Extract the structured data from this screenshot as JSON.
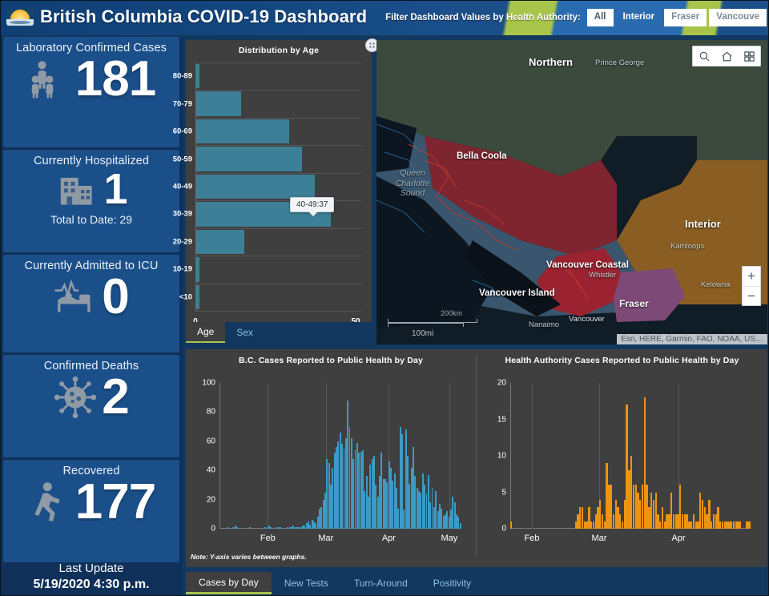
{
  "header": {
    "title": "British Columbia COVID-19 Dashboard",
    "logo_icon": "bc-sun-logo",
    "filter_label": "Filter Dashboard Values by Health Authority:",
    "filters": [
      {
        "label": "All",
        "state": "selected"
      },
      {
        "label": "Interior",
        "state": "unselected"
      },
      {
        "label": "Fraser",
        "state": "box"
      },
      {
        "label": "Vancouve",
        "state": "box"
      }
    ],
    "accent_green": "#a8c44a",
    "brand_blue": "#1b4f8a"
  },
  "kpis": [
    {
      "title": "Laboratory Confirmed Cases",
      "value": "181",
      "sub": "",
      "icon": "people-icon"
    },
    {
      "title": "Currently Hospitalized",
      "value": "1",
      "sub": "Total to Date: 29",
      "icon": "hospital-icon"
    },
    {
      "title": "Currently Admitted to ICU",
      "value": "0",
      "sub": "",
      "icon": "icu-bed-icon"
    },
    {
      "title": "Confirmed Deaths",
      "value": "2",
      "sub": "",
      "icon": "virus-icon"
    },
    {
      "title": "Recovered",
      "value": "177",
      "sub": "",
      "icon": "walking-person-icon"
    }
  ],
  "last_update": {
    "label": "Last Update",
    "datetime": "5/19/2020 4:30 p.m."
  },
  "age_panel": {
    "expand_icon": "expand-options-icon",
    "tabs": [
      {
        "label": "Age",
        "active": true
      },
      {
        "label": "Sex",
        "active": false
      }
    ],
    "tooltip": "40-49:37"
  },
  "map": {
    "tools": [
      {
        "name": "search-icon",
        "label": "Search"
      },
      {
        "name": "home-icon",
        "label": "Default extent"
      },
      {
        "name": "basemap-gallery-icon",
        "label": "Basemap gallery"
      }
    ],
    "zoom_in": "+",
    "zoom_out": "−",
    "scale_km": "200km",
    "scale_mi": "100mi",
    "attribution": "Esri, HERE, Garmin, FAO, NOAA, US…",
    "regions": [
      {
        "label": "Northern",
        "color": "#3d4a3a"
      },
      {
        "label": "Interior",
        "color": "#8a5a1e"
      },
      {
        "label": "Vancouver Coastal",
        "color": "#8c2330"
      },
      {
        "label": "Fraser",
        "color": "#7d4a78"
      },
      {
        "label": "Vancouver Island",
        "color": "#3c5870"
      }
    ],
    "cities": [
      "Prince George",
      "Bella Coola",
      "Kamloops",
      "Kelowna",
      "Whistler",
      "Vancouver",
      "Nanaimo"
    ],
    "water_labels": [
      "Queen\nCharlotte\nSound"
    ]
  },
  "bottom": {
    "note": "Note: Y-axis varies between graphs.",
    "tabs": [
      {
        "label": "Cases by Day",
        "active": true
      },
      {
        "label": "New Tests",
        "active": false
      },
      {
        "label": "Turn-Around",
        "active": false
      },
      {
        "label": "Positivity",
        "active": false
      }
    ]
  },
  "chart_data": [
    {
      "type": "bar",
      "id": "distribution-by-age",
      "title": "Distribution by Age",
      "orientation": "horizontal",
      "xlabel": "",
      "ylabel": "",
      "xlim": [
        0,
        50
      ],
      "xticks": [
        0,
        50
      ],
      "xtick_labels": [
        "0",
        "50"
      ],
      "grid": true,
      "bar_color": "#3d7f96",
      "categories": [
        "80-89",
        "70-79",
        "60-69",
        "50-59",
        "40-49",
        "30-39",
        "20-29",
        "10-19",
        "<10"
      ],
      "values": [
        1,
        14,
        29,
        33,
        37,
        42,
        15,
        1,
        1
      ],
      "annotation": {
        "text": "40-49:37",
        "category": "40-49",
        "value": 37
      }
    },
    {
      "type": "bar",
      "id": "bc-cases-by-day",
      "title": "B.C. Cases Reported to Public Health by Day",
      "xlabel": "",
      "ylabel": "",
      "ylim": [
        0,
        100
      ],
      "yticks": [
        0,
        20,
        40,
        60,
        80,
        100
      ],
      "xtick_labels": [
        "Feb",
        "Mar",
        "Apr",
        "May"
      ],
      "grid": true,
      "bar_color": "#3c9bc4",
      "values": [
        0,
        0,
        0,
        0,
        1,
        0,
        0,
        1,
        2,
        1,
        0,
        0,
        0,
        0,
        0,
        0,
        1,
        0,
        0,
        0,
        0,
        0,
        0,
        0,
        1,
        1,
        2,
        1,
        0,
        0,
        1,
        1,
        1,
        0,
        0,
        0,
        1,
        1,
        1,
        2,
        1,
        1,
        1,
        1,
        2,
        2,
        4,
        5,
        3,
        6,
        5,
        4,
        8,
        14,
        15,
        20,
        25,
        48,
        45,
        30,
        42,
        52,
        56,
        60,
        66,
        58,
        55,
        62,
        88,
        70,
        62,
        48,
        54,
        59,
        52,
        53,
        54,
        26,
        36,
        22,
        44,
        48,
        50,
        30,
        22,
        36,
        52,
        34,
        34,
        32,
        46,
        42,
        33,
        38,
        28,
        14,
        70,
        65,
        13,
        68,
        50,
        31,
        42,
        56,
        36,
        28,
        26,
        25,
        38,
        30,
        24,
        37,
        18,
        28,
        15,
        26,
        12,
        17,
        14,
        9,
        10,
        12,
        8,
        13,
        22,
        18,
        10,
        8,
        4
      ]
    },
    {
      "type": "bar",
      "id": "health-authority-cases-by-day",
      "title": "Health Authority Cases Reported to Public Health by Day",
      "xlabel": "",
      "ylabel": "",
      "ylim": [
        0,
        20
      ],
      "yticks": [
        0,
        5,
        10,
        15,
        20
      ],
      "xtick_labels": [
        "Feb",
        "Mar",
        "Apr"
      ],
      "grid": true,
      "bar_color": "#ef9412",
      "values": [
        1,
        0,
        0,
        0,
        0,
        0,
        0,
        0,
        0,
        0,
        0,
        0,
        0,
        0,
        0,
        0,
        0,
        0,
        0,
        0,
        0,
        0,
        0,
        0,
        0,
        0,
        0,
        0,
        0,
        1,
        2,
        3,
        3,
        1,
        1,
        3,
        1,
        1,
        2,
        3,
        4,
        2,
        1,
        9,
        6,
        6,
        2,
        4,
        3,
        2,
        1,
        4,
        17,
        8,
        10,
        6,
        6,
        5,
        4,
        6,
        18,
        6,
        3,
        5,
        4,
        5,
        2,
        1,
        3,
        1,
        2,
        2,
        5,
        2,
        2,
        2,
        6,
        2,
        2,
        2,
        1,
        1,
        2,
        1,
        1,
        5,
        4,
        3,
        2,
        4,
        1,
        2,
        2,
        3,
        1,
        1,
        1,
        1,
        1,
        1,
        1,
        1,
        1,
        1,
        0,
        0,
        1,
        1
      ]
    }
  ]
}
